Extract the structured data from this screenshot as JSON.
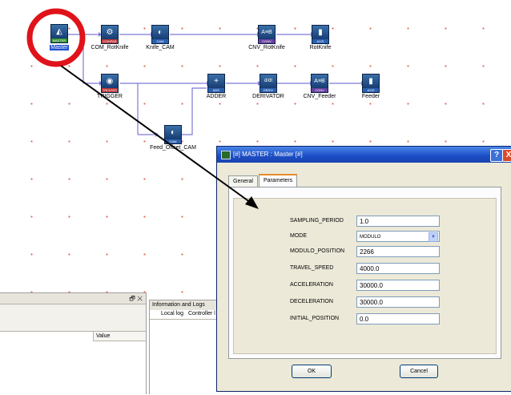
{
  "diagram": {
    "nodes": [
      {
        "id": "master",
        "label": "Master",
        "tag": "MASTER",
        "glyph": "◭",
        "selected": true
      },
      {
        "id": "com_rotknife",
        "label": "COM_RotKnife",
        "tag": "COMPAR",
        "glyph": "⚙"
      },
      {
        "id": "knife_cam",
        "label": "Knife_CAM",
        "tag": "CAM",
        "glyph": "◐"
      },
      {
        "id": "cnv_rotknife",
        "label": "CNV_RotKnife",
        "tag": "CONV",
        "glyph": "A≡B"
      },
      {
        "id": "rotknife",
        "label": "RotKnife",
        "tag": "AXIS",
        "glyph": "▮"
      },
      {
        "id": "trigger",
        "label": "TRIGGER",
        "tag": "TRIGGER",
        "glyph": "◉"
      },
      {
        "id": "adder",
        "label": "ADDER",
        "tag": "ADD",
        "glyph": "+"
      },
      {
        "id": "derivator",
        "label": "DERIVATOR",
        "tag": "DERIV",
        "glyph": "d/dt"
      },
      {
        "id": "cnv_feeder",
        "label": "CNV_Feeder",
        "tag": "CONV",
        "glyph": "A≡B"
      },
      {
        "id": "feeder",
        "label": "Feeder",
        "tag": "AXIS",
        "glyph": "▮"
      },
      {
        "id": "feed_offset_cam",
        "label": "Feed_Offset_CAM",
        "tag": "CAM",
        "glyph": "◐"
      }
    ]
  },
  "properties_panel": {
    "close_glyph": "✕",
    "pin_glyph": "🗗",
    "column_value": "Value"
  },
  "info_panel": {
    "title": "Information and Logs",
    "tab_local": "Local log",
    "tab_controller": "Controller l"
  },
  "dialog": {
    "title": "[#] MASTER : Master [#]",
    "help_glyph": "?",
    "close_glyph": "X",
    "tabs": {
      "general": "General",
      "parameters": "Parameters"
    },
    "params": [
      {
        "label": "SAMPLING_PERIOD",
        "value": "1.0"
      },
      {
        "label": "MODE",
        "value": "MODULO",
        "type": "select"
      },
      {
        "label": "MODULO_POSITION",
        "value": "2266"
      },
      {
        "label": "TRAVEL_SPEED",
        "value": "4000.0"
      },
      {
        "label": "ACCELERATION",
        "value": "30000.0"
      },
      {
        "label": "DECELERATION",
        "value": "30000.0"
      },
      {
        "label": "INITIAL_POSITION",
        "value": "0.0"
      }
    ],
    "ok_label": "OK",
    "cancel_label": "Cancel"
  },
  "colors": {
    "ring": "#e0121a",
    "wire": "#7d7ad8",
    "arrow": "#000000",
    "grid_dot": "#e06a5a"
  }
}
